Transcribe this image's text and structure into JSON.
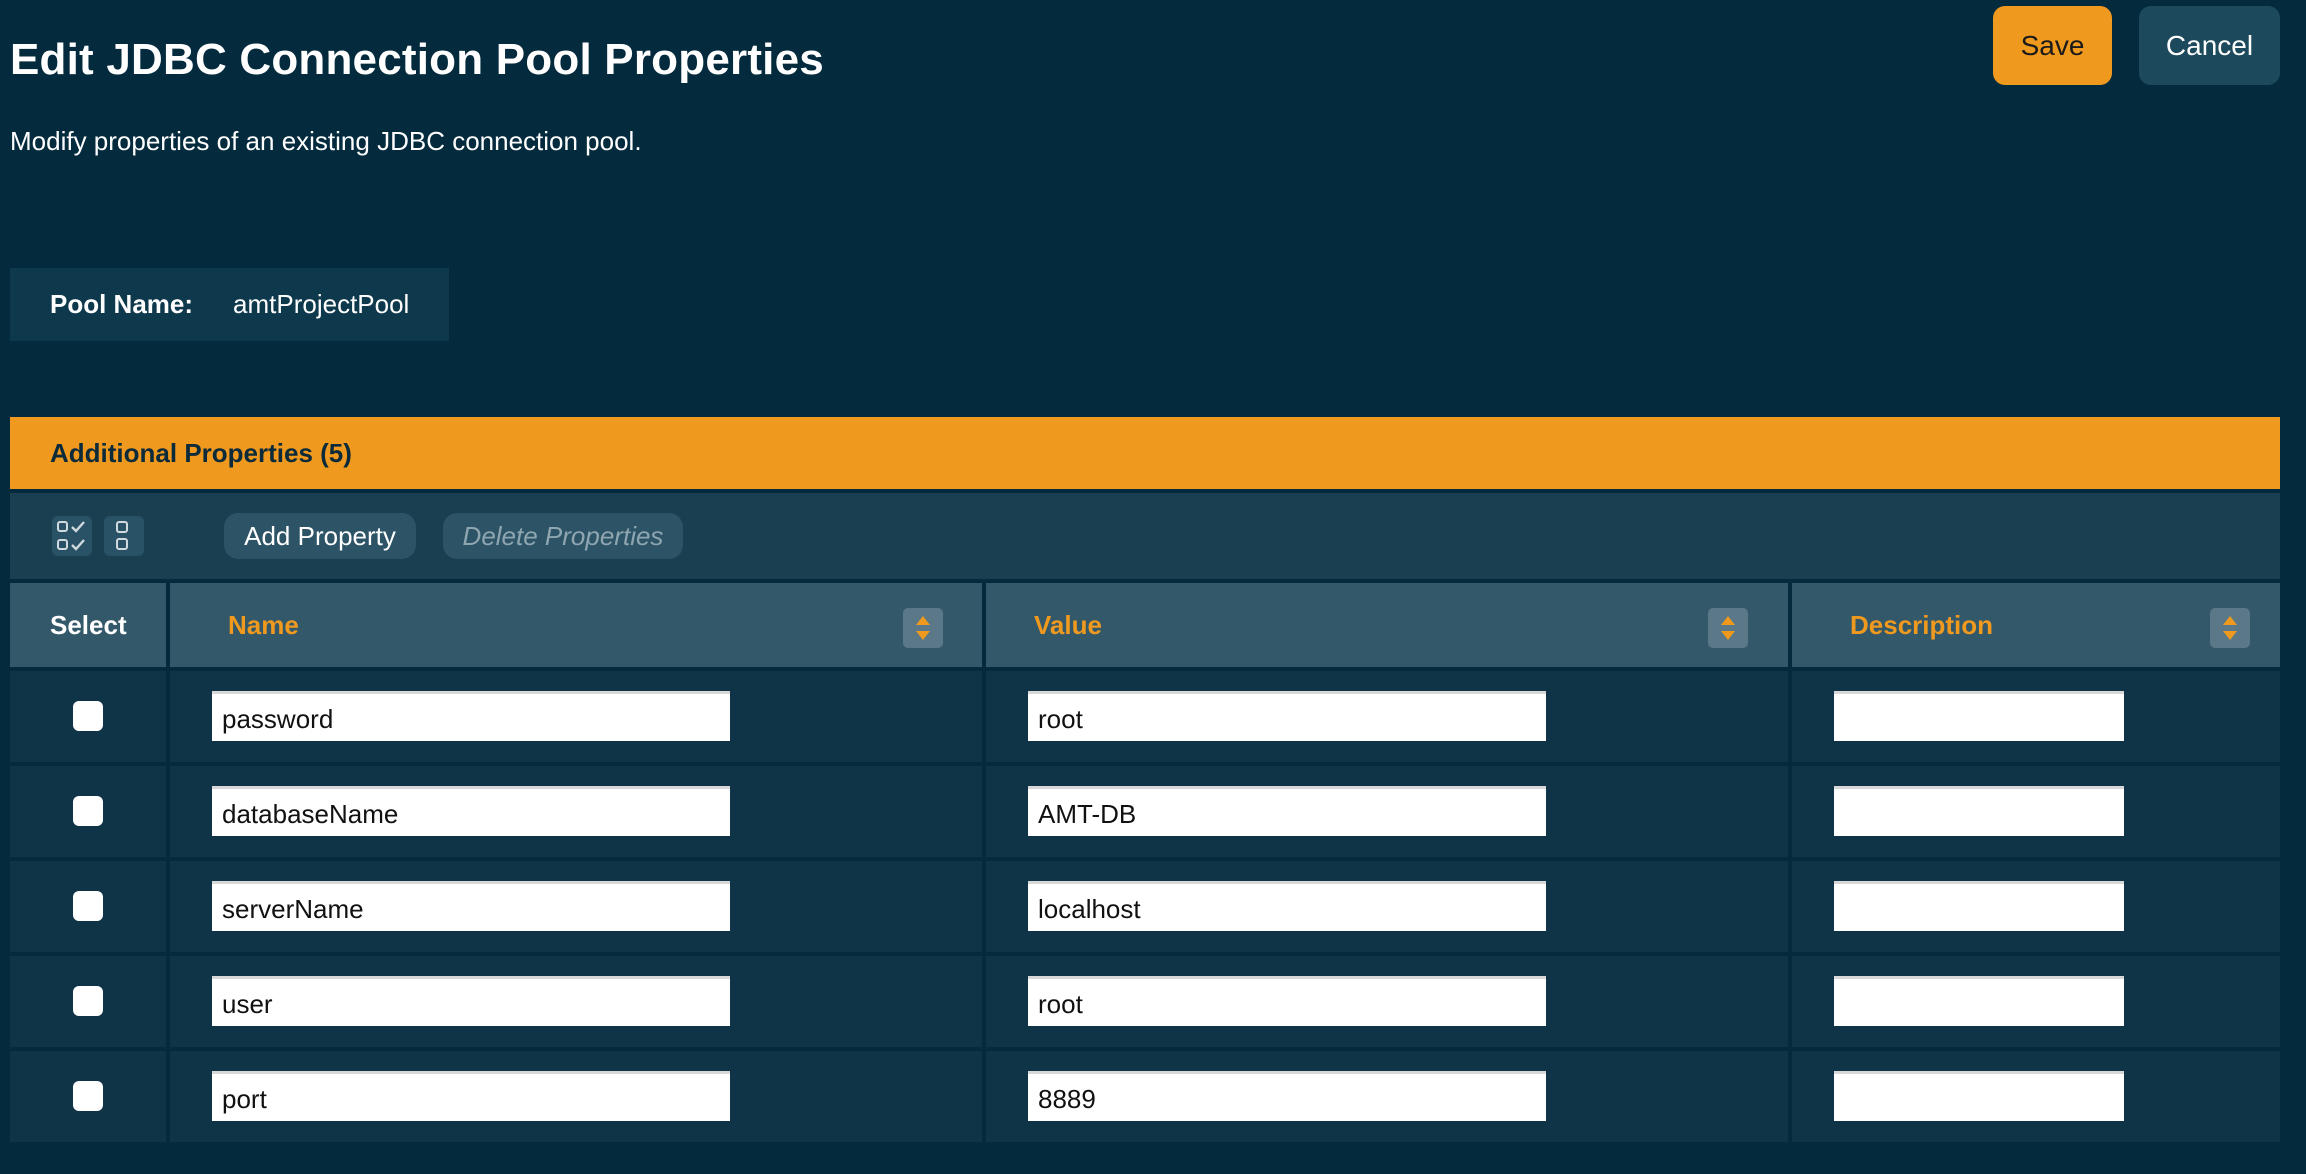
{
  "header": {
    "title": "Edit JDBC Connection Pool Properties",
    "description": "Modify properties of an existing JDBC connection pool.",
    "save_label": "Save",
    "cancel_label": "Cancel"
  },
  "pool": {
    "label": "Pool Name:",
    "value": "amtProjectPool"
  },
  "section": {
    "title": "Additional Properties (5)"
  },
  "toolbar": {
    "select_all_icon": "select-all-icon",
    "deselect_all_icon": "deselect-all-icon",
    "add_label": "Add Property",
    "delete_label": "Delete Properties"
  },
  "table": {
    "columns": [
      "Select",
      "Name",
      "Value",
      "Description"
    ],
    "rows": [
      {
        "selected": false,
        "name": "password",
        "value": "root",
        "description": ""
      },
      {
        "selected": false,
        "name": "databaseName",
        "value": "AMT-DB",
        "description": ""
      },
      {
        "selected": false,
        "name": "serverName",
        "value": "localhost",
        "description": ""
      },
      {
        "selected": false,
        "name": "user",
        "value": "root",
        "description": ""
      },
      {
        "selected": false,
        "name": "port",
        "value": "8889",
        "description": ""
      }
    ]
  },
  "colors": {
    "background": "#032a3d",
    "accent": "#ef991f",
    "header_cell": "#335869",
    "row_cell": "#0f3447",
    "column_title": "#ef991f"
  }
}
